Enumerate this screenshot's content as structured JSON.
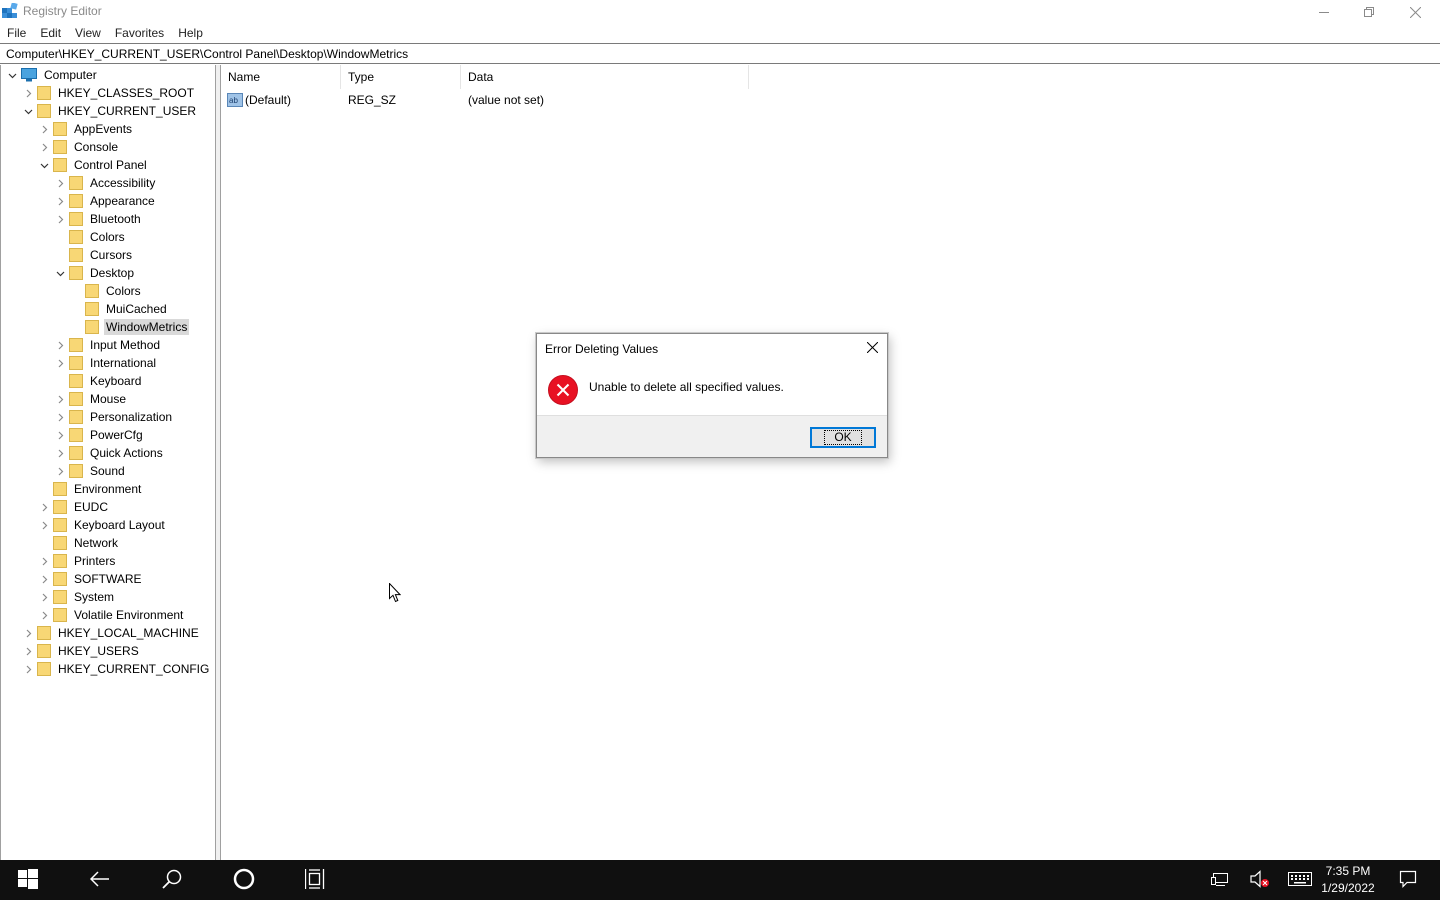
{
  "window": {
    "title": "Registry Editor",
    "minimize_glyph": "minimize-icon",
    "restore_glyph": "restore-icon",
    "close_glyph": "close-icon"
  },
  "menu": [
    "File",
    "Edit",
    "View",
    "Favorites",
    "Help"
  ],
  "address": "Computer\\HKEY_CURRENT_USER\\Control Panel\\Desktop\\WindowMetrics",
  "tree": {
    "root": "Computer",
    "nodes": [
      {
        "label": "HKEY_CLASSES_ROOT",
        "level": 1,
        "expander": "collapsed"
      },
      {
        "label": "HKEY_CURRENT_USER",
        "level": 1,
        "expander": "expanded"
      },
      {
        "label": "AppEvents",
        "level": 2,
        "expander": "collapsed"
      },
      {
        "label": "Console",
        "level": 2,
        "expander": "collapsed"
      },
      {
        "label": "Control Panel",
        "level": 2,
        "expander": "expanded"
      },
      {
        "label": "Accessibility",
        "level": 3,
        "expander": "collapsed"
      },
      {
        "label": "Appearance",
        "level": 3,
        "expander": "collapsed"
      },
      {
        "label": "Bluetooth",
        "level": 3,
        "expander": "collapsed"
      },
      {
        "label": "Colors",
        "level": 3,
        "expander": "none"
      },
      {
        "label": "Cursors",
        "level": 3,
        "expander": "none"
      },
      {
        "label": "Desktop",
        "level": 3,
        "expander": "expanded"
      },
      {
        "label": "Colors",
        "level": 4,
        "expander": "none"
      },
      {
        "label": "MuiCached",
        "level": 4,
        "expander": "none"
      },
      {
        "label": "WindowMetrics",
        "level": 4,
        "expander": "none",
        "selected": true
      },
      {
        "label": "Input Method",
        "level": 3,
        "expander": "collapsed"
      },
      {
        "label": "International",
        "level": 3,
        "expander": "collapsed"
      },
      {
        "label": "Keyboard",
        "level": 3,
        "expander": "none"
      },
      {
        "label": "Mouse",
        "level": 3,
        "expander": "collapsed"
      },
      {
        "label": "Personalization",
        "level": 3,
        "expander": "collapsed"
      },
      {
        "label": "PowerCfg",
        "level": 3,
        "expander": "collapsed"
      },
      {
        "label": "Quick Actions",
        "level": 3,
        "expander": "collapsed"
      },
      {
        "label": "Sound",
        "level": 3,
        "expander": "collapsed"
      },
      {
        "label": "Environment",
        "level": 2,
        "expander": "none"
      },
      {
        "label": "EUDC",
        "level": 2,
        "expander": "collapsed"
      },
      {
        "label": "Keyboard Layout",
        "level": 2,
        "expander": "collapsed"
      },
      {
        "label": "Network",
        "level": 2,
        "expander": "none"
      },
      {
        "label": "Printers",
        "level": 2,
        "expander": "collapsed"
      },
      {
        "label": "SOFTWARE",
        "level": 2,
        "expander": "collapsed"
      },
      {
        "label": "System",
        "level": 2,
        "expander": "collapsed"
      },
      {
        "label": "Volatile Environment",
        "level": 2,
        "expander": "collapsed"
      },
      {
        "label": "HKEY_LOCAL_MACHINE",
        "level": 1,
        "expander": "collapsed"
      },
      {
        "label": "HKEY_USERS",
        "level": 1,
        "expander": "collapsed"
      },
      {
        "label": "HKEY_CURRENT_CONFIG",
        "level": 1,
        "expander": "collapsed"
      }
    ]
  },
  "list": {
    "columns": [
      "Name",
      "Type",
      "Data"
    ],
    "rows": [
      {
        "icon": "string-value-icon",
        "name": "(Default)",
        "type": "REG_SZ",
        "data": "(value not set)"
      }
    ]
  },
  "dialog": {
    "title": "Error Deleting Values",
    "icon": "error-icon",
    "message": "Unable to delete all specified values.",
    "ok_label": "OK"
  },
  "taskbar": {
    "icons": [
      "start-icon",
      "back-icon",
      "search-icon",
      "cortana-icon",
      "task-view-icon"
    ],
    "tray_icons": [
      "network-icon",
      "volume-muted-icon",
      "keyboard-icon",
      "action-center-icon"
    ],
    "time": "7:35 PM",
    "date": "1/29/2022"
  },
  "colors": {
    "accent": "#0078d7",
    "folder": "#f8d775",
    "error": "#e81123",
    "taskbar": "#101010",
    "selection": "#d9d9d9"
  }
}
